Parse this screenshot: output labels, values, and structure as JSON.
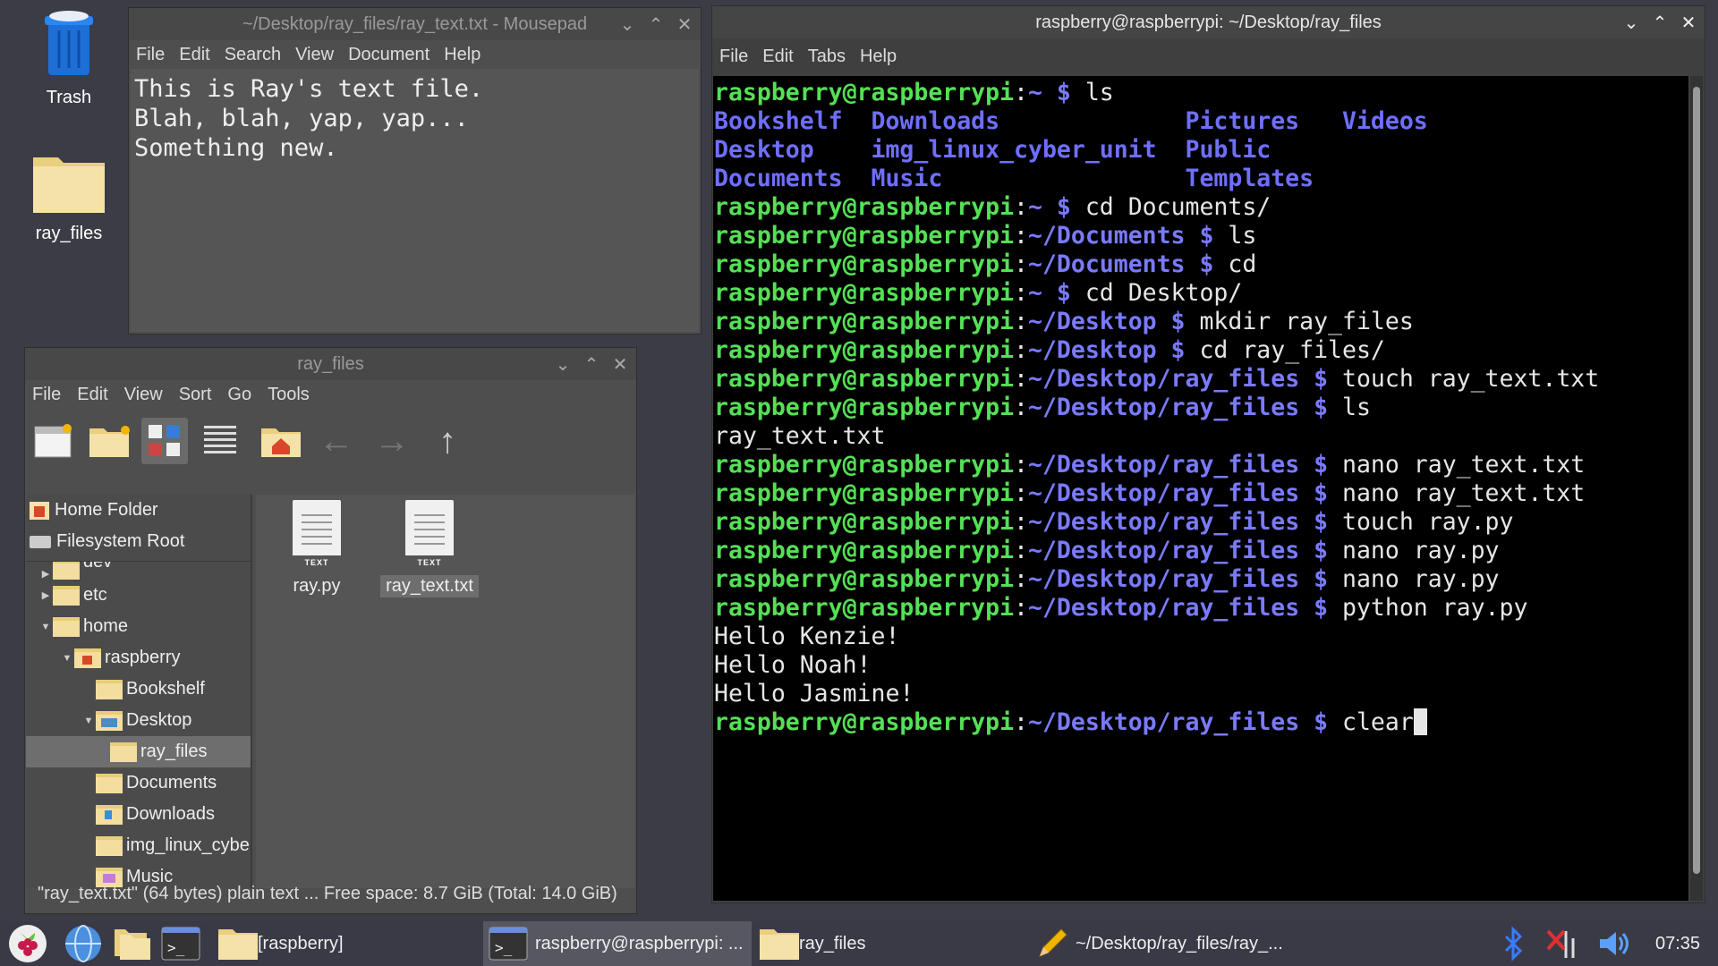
{
  "desktop": {
    "trash_label": "Trash",
    "folder_label": "ray_files"
  },
  "mousepad": {
    "title": "~/Desktop/ray_files/ray_text.txt - Mousepad",
    "menu": [
      "File",
      "Edit",
      "Search",
      "View",
      "Document",
      "Help"
    ],
    "content": "This is Ray's text file.\nBlah, blah, yap, yap...\nSomething new."
  },
  "filemanager": {
    "title": "ray_files",
    "menu": [
      "File",
      "Edit",
      "View",
      "Sort",
      "Go",
      "Tools"
    ],
    "places": [
      "Home Folder",
      "Filesystem Root"
    ],
    "tree": [
      "dev",
      "etc",
      "home",
      "raspberry",
      "Bookshelf",
      "Desktop",
      "ray_files",
      "Documents",
      "Downloads",
      "img_linux_cybe",
      "Music"
    ],
    "files": [
      "ray.py",
      "ray_text.txt"
    ],
    "file_tag": "TEXT",
    "status": "\"ray_text.txt\" (64 bytes) plain text ... Free space: 8.7 GiB (Total: 14.0 GiB)"
  },
  "terminal": {
    "title": "raspberry@raspberrypi: ~/Desktop/ray_files",
    "menu": [
      "File",
      "Edit",
      "Tabs",
      "Help"
    ],
    "user": "raspberry@raspberrypi",
    "lines": [
      {
        "t": "p",
        "path": "~",
        "cmd": "ls"
      },
      {
        "t": "dirs",
        "cols": [
          "Bookshelf",
          "Downloads",
          "Pictures",
          "Videos"
        ]
      },
      {
        "t": "dirs",
        "cols": [
          "Desktop",
          "img_linux_cyber_unit",
          "Public",
          ""
        ]
      },
      {
        "t": "dirs",
        "cols": [
          "Documents",
          "Music",
          "Templates",
          ""
        ]
      },
      {
        "t": "p",
        "path": "~",
        "cmd": "cd Documents/"
      },
      {
        "t": "p",
        "path": "~/Documents",
        "cmd": "ls"
      },
      {
        "t": "p",
        "path": "~/Documents",
        "cmd": "cd"
      },
      {
        "t": "p",
        "path": "~",
        "cmd": "cd Desktop/"
      },
      {
        "t": "p",
        "path": "~/Desktop",
        "cmd": "mkdir ray_files"
      },
      {
        "t": "p",
        "path": "~/Desktop",
        "cmd": "cd ray_files/"
      },
      {
        "t": "p",
        "path": "~/Desktop/ray_files",
        "cmd": "touch ray_text.txt"
      },
      {
        "t": "p",
        "path": "~/Desktop/ray_files",
        "cmd": "ls"
      },
      {
        "t": "o",
        "text": "ray_text.txt"
      },
      {
        "t": "p",
        "path": "~/Desktop/ray_files",
        "cmd": "nano ray_text.txt"
      },
      {
        "t": "p",
        "path": "~/Desktop/ray_files",
        "cmd": "nano ray_text.txt"
      },
      {
        "t": "p",
        "path": "~/Desktop/ray_files",
        "cmd": "touch ray.py"
      },
      {
        "t": "p",
        "path": "~/Desktop/ray_files",
        "cmd": "nano ray.py"
      },
      {
        "t": "p",
        "path": "~/Desktop/ray_files",
        "cmd": "nano ray.py"
      },
      {
        "t": "p",
        "path": "~/Desktop/ray_files",
        "cmd": "python ray.py"
      },
      {
        "t": "o",
        "text": "Hello Kenzie!"
      },
      {
        "t": "o",
        "text": "Hello Noah!"
      },
      {
        "t": "o",
        "text": "Hello Jasmine!"
      },
      {
        "t": "p",
        "path": "~/Desktop/ray_files",
        "cmd": "clear",
        "cursor": true
      }
    ]
  },
  "taskbar": {
    "tasks": [
      "[raspberry]",
      "raspberry@raspberrypi: ...",
      "ray_files",
      "~/Desktop/ray_files/ray_..."
    ],
    "clock": "07:35"
  },
  "colors": {
    "prompt_user": "#55e055",
    "prompt_path": "#7a7aff",
    "accent": "#c51a4a"
  }
}
